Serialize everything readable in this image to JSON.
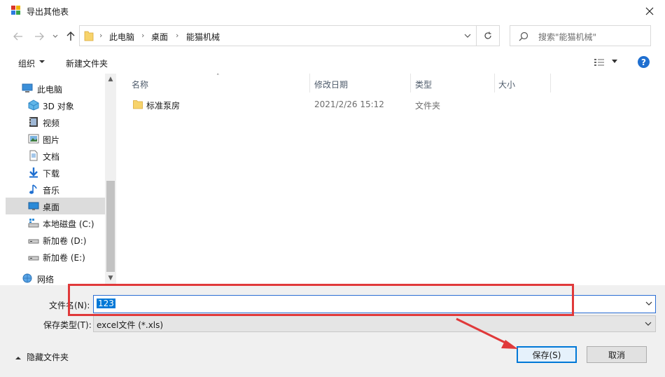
{
  "window": {
    "title": "导出其他表"
  },
  "address": {
    "crumbs": [
      "此电脑",
      "桌面",
      "能猫机械"
    ],
    "search_placeholder": "搜索\"能猫机械\""
  },
  "toolbar": {
    "organize_label": "组织",
    "new_folder_label": "新建文件夹"
  },
  "nav": {
    "items": [
      {
        "label": "此电脑",
        "icon": "computer-icon"
      },
      {
        "label": "3D 对象",
        "icon": "3d-objects-icon"
      },
      {
        "label": "视频",
        "icon": "video-icon"
      },
      {
        "label": "图片",
        "icon": "pictures-icon"
      },
      {
        "label": "文档",
        "icon": "documents-icon"
      },
      {
        "label": "下载",
        "icon": "download-icon"
      },
      {
        "label": "音乐",
        "icon": "music-icon"
      },
      {
        "label": "桌面",
        "icon": "desktop-icon",
        "selected": true
      },
      {
        "label": "本地磁盘 (C:)",
        "icon": "drive-c-icon"
      },
      {
        "label": "新加卷 (D:)",
        "icon": "drive-icon"
      },
      {
        "label": "新加卷 (E:)",
        "icon": "drive-icon"
      },
      {
        "label": "网络",
        "icon": "network-icon"
      }
    ]
  },
  "filelist": {
    "columns": [
      "名称",
      "修改日期",
      "类型",
      "大小"
    ],
    "rows": [
      {
        "name": "标准泵房",
        "date": "2021/2/26 15:12",
        "type": "文件夹",
        "size": ""
      }
    ]
  },
  "form": {
    "filename_label": "文件名(N):",
    "filename_value": "123",
    "filetype_label": "保存类型(T):",
    "filetype_value": "excel文件 (*.xls)",
    "hide_folders_label": "隐藏文件夹",
    "save_label": "保存(S)",
    "cancel_label": "取消"
  },
  "colors": {
    "accent": "#0078d7",
    "annotation": "#e0393a",
    "selection": "#dcdcdc"
  }
}
